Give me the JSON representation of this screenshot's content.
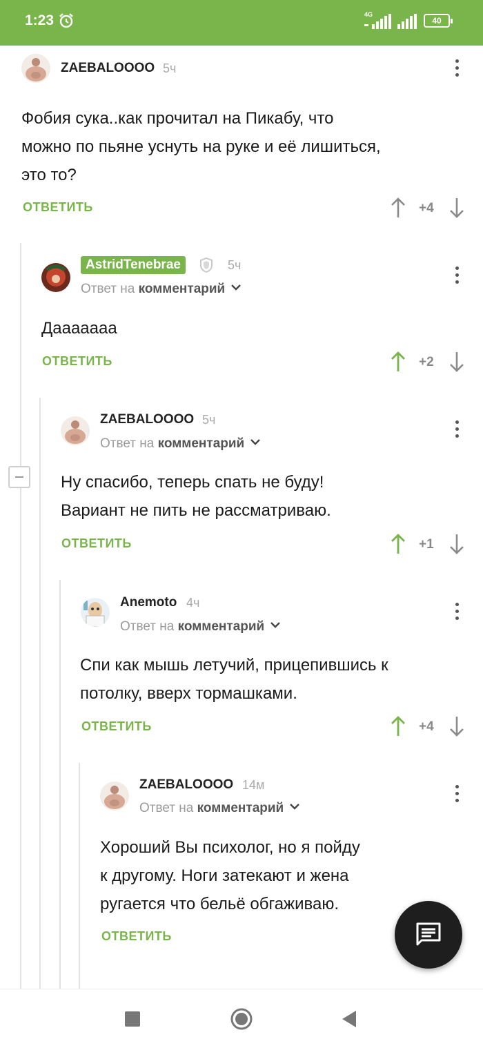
{
  "status_bar": {
    "time": "1:23",
    "network_label": "4G",
    "battery": "40",
    "colors": {
      "bg": "#79b54b"
    }
  },
  "labels": {
    "reply": "ОТВЕТИТЬ",
    "reply_to_prefix": "Ответ на",
    "reply_to_target": "комментарий"
  },
  "comments": [
    {
      "author": "ZAEBALOOOO",
      "time": "5ч",
      "text_lines": [
        "Фобия сука..как прочитал на Пикабу, что",
        "можно по пьяне уснуть на руке и её лишиться,",
        "это то?"
      ],
      "rating": "+4",
      "upvoted": false
    },
    {
      "author": "AstridTenebrae",
      "time": "5ч",
      "text_lines": [
        "Дааааааа"
      ],
      "rating": "+2",
      "upvoted": true
    },
    {
      "author": "ZAEBALOOOO",
      "time": "5ч",
      "text_lines": [
        "Ну спасибо, теперь спать не буду!",
        "Вариант не пить не рассматриваю."
      ],
      "rating": "+1",
      "upvoted": true
    },
    {
      "author": "Anemoto",
      "time": "4ч",
      "text_lines": [
        "Спи как мышь летучий, прицепившись к",
        "потолку, вверх тормашками."
      ],
      "rating": "+4",
      "upvoted": true
    },
    {
      "author": "ZAEBALOOOO",
      "time": "14м",
      "text_lines": [
        "Хороший Вы психолог, но я пойду",
        "к другому. Ноги затекают и жена",
        "ругается что бельё обгаживаю."
      ],
      "rating": "",
      "upvoted": false
    }
  ],
  "colors": {
    "accent": "#79b54b",
    "arrow_neutral": "#8a8a8a",
    "fab": "#1e1e1e"
  },
  "icons": {
    "fab": "comment-icon",
    "nav": [
      "square-icon",
      "circle-home-icon",
      "triangle-back-icon"
    ]
  }
}
